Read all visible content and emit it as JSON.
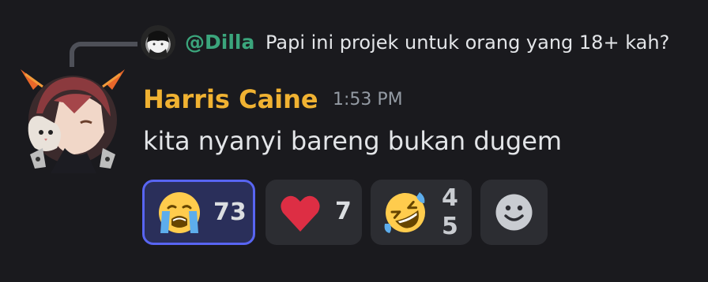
{
  "reply": {
    "author": "@Dilla",
    "text": "Papi ini projek untuk orang yang 18+ kah?",
    "author_color": "#3ba57c"
  },
  "message": {
    "author": "Harris Caine",
    "author_color": "#f0b232",
    "timestamp": "1:53 PM",
    "text": "kita nyanyi bareng bukan dugem"
  },
  "reactions": [
    {
      "emoji": "loudly-crying-face",
      "count": "73",
      "active": true
    },
    {
      "emoji": "red-heart",
      "count": "7",
      "active": false
    },
    {
      "emoji": "rolling-on-the-floor-laughing",
      "count": "45",
      "active": false
    }
  ],
  "add_reaction": {
    "icon": "add-reaction-smiley-icon"
  },
  "colors": {
    "background": "#1a1a1e",
    "active_reaction_border": "#5865f2",
    "reaction_background": "#2c2d32"
  }
}
